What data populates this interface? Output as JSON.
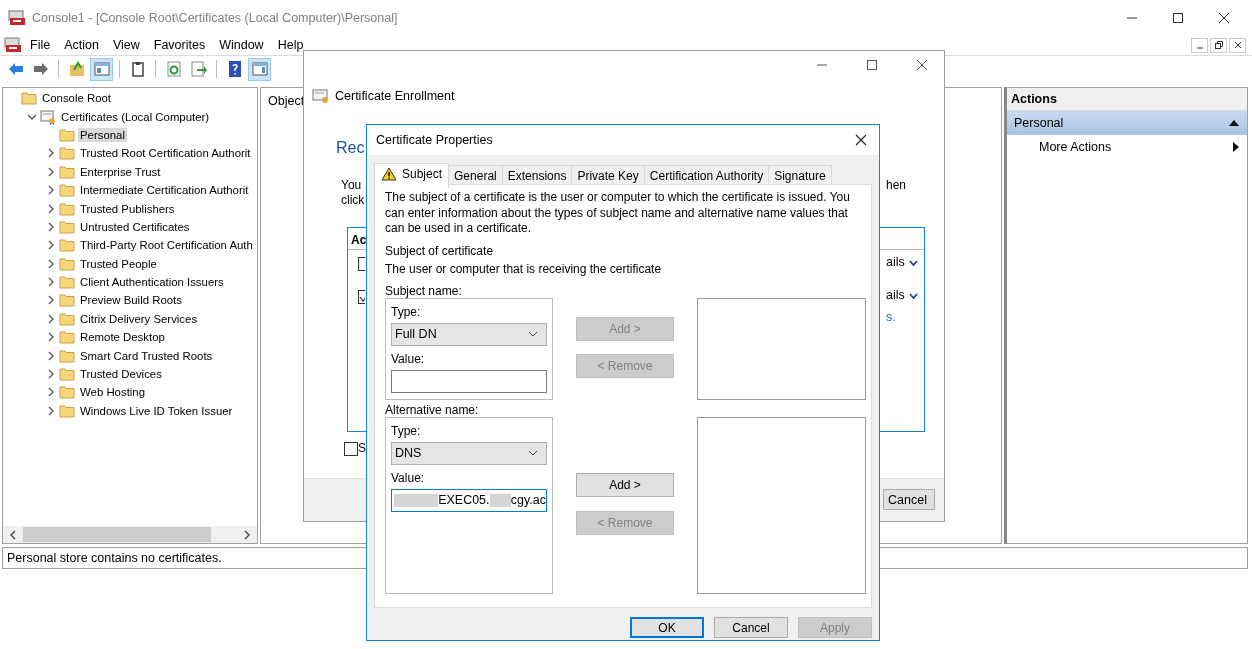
{
  "window": {
    "title": "Console1 - [Console Root\\Certificates (Local Computer)\\Personal]"
  },
  "menu": [
    "File",
    "Action",
    "View",
    "Favorites",
    "Window",
    "Help"
  ],
  "toolbar": [
    {
      "kind": "back",
      "pressed": false
    },
    {
      "kind": "forward",
      "pressed": false
    },
    {
      "kind": "separator"
    },
    {
      "kind": "up",
      "pressed": false
    },
    {
      "kind": "tree",
      "pressed": true
    },
    {
      "kind": "separator"
    },
    {
      "kind": "clipboard",
      "pressed": false
    },
    {
      "kind": "separator"
    },
    {
      "kind": "refresh",
      "pressed": false
    },
    {
      "kind": "export",
      "pressed": false
    },
    {
      "kind": "separator"
    },
    {
      "kind": "help",
      "pressed": false
    },
    {
      "kind": "pane",
      "pressed": true
    }
  ],
  "tree": [
    {
      "label": "Console Root",
      "selected": false,
      "children": [
        {
          "label": "Certificates (Local Computer)",
          "selected": false,
          "expanded": true,
          "children": [
            {
              "label": "Personal",
              "selected": true
            },
            {
              "label": "Trusted Root Certification Authorit",
              "selected": false,
              "expanded": false
            },
            {
              "label": "Enterprise Trust",
              "selected": false,
              "expanded": false
            },
            {
              "label": "Intermediate Certification Authorit",
              "selected": false,
              "expanded": false
            },
            {
              "label": "Trusted Publishers",
              "selected": false,
              "expanded": false
            },
            {
              "label": "Untrusted Certificates",
              "selected": false,
              "expanded": false
            },
            {
              "label": "Third-Party Root Certification Auth",
              "selected": false,
              "expanded": false
            },
            {
              "label": "Trusted People",
              "selected": false,
              "expanded": false
            },
            {
              "label": "Client Authentication Issuers",
              "selected": false,
              "expanded": false
            },
            {
              "label": "Preview Build Roots",
              "selected": false,
              "expanded": false
            },
            {
              "label": "Citrix Delivery Services",
              "selected": false,
              "expanded": false
            },
            {
              "label": "Remote Desktop",
              "selected": false,
              "expanded": false
            },
            {
              "label": "Smart Card Trusted Roots",
              "selected": false,
              "expanded": false
            },
            {
              "label": "Trusted Devices",
              "selected": false,
              "expanded": false
            },
            {
              "label": "Web Hosting",
              "selected": false,
              "expanded": false
            },
            {
              "label": "Windows Live ID Token Issuer",
              "selected": false,
              "expanded": false
            }
          ]
        }
      ]
    }
  ],
  "results": {
    "column_1": "Object"
  },
  "actions": {
    "title": "Actions",
    "sections": [
      {
        "label": "Personal",
        "expanded": true,
        "items": [
          {
            "label": "More Actions",
            "submenu": true
          }
        ]
      }
    ]
  },
  "status_bar": "Personal store contains no certificates.",
  "enrollment": {
    "title": "Certificate Enrollment",
    "heading": "Rec",
    "intro": [
      "You",
      "click"
    ],
    "intro_right": "hen",
    "list_header": "Ac",
    "rows": [
      {
        "checked": false,
        "details": "ails"
      },
      {
        "checked": true,
        "details": "ails"
      }
    ],
    "link": "s.",
    "option": {
      "checked": false,
      "label": "S"
    },
    "buttons": [
      "Cancel"
    ]
  },
  "properties": {
    "title": "Certificate Properties",
    "tabs": [
      {
        "label": "Subject",
        "selected": true,
        "warning": true
      },
      {
        "label": "General",
        "selected": false,
        "warning": false
      },
      {
        "label": "Extensions",
        "selected": false,
        "warning": false
      },
      {
        "label": "Private Key",
        "selected": false,
        "warning": false
      },
      {
        "label": "Certification Authority",
        "selected": false,
        "warning": false
      },
      {
        "label": "Signature",
        "selected": false,
        "warning": false
      }
    ],
    "description": "The subject of a certificate is the user or computer to which the certificate is issued. You can enter information about the types of subject name and alternative name values that can be used in a certificate.",
    "section": "Subject of certificate",
    "section_note": "The user or computer that is receiving the certificate",
    "groups": [
      {
        "label": "Subject name:",
        "type_label": "Type:",
        "type": "Full DN",
        "value_label": "Value:",
        "focused": false,
        "buttons": [
          {
            "label": "Add >",
            "disabled": true
          },
          {
            "label": "< Remove",
            "disabled": true
          }
        ]
      },
      {
        "label": "Alternative name:",
        "type_label": "Type:",
        "type": "DNS",
        "value_label": "Value:",
        "focused": true,
        "value_parts": [
          {
            "kind": "redacted"
          },
          {
            "kind": "text",
            "text": "EXEC05."
          },
          {
            "kind": "redacted"
          },
          {
            "kind": "text",
            "text": "cgy.ac"
          }
        ],
        "buttons": [
          {
            "label": "Add >",
            "disabled": false
          },
          {
            "label": "< Remove",
            "disabled": true
          }
        ]
      }
    ],
    "buttons": [
      {
        "label": "OK",
        "default": true,
        "disabled": false
      },
      {
        "label": "Cancel",
        "default": false,
        "disabled": false
      },
      {
        "label": "Apply",
        "default": false,
        "disabled": true
      }
    ]
  }
}
